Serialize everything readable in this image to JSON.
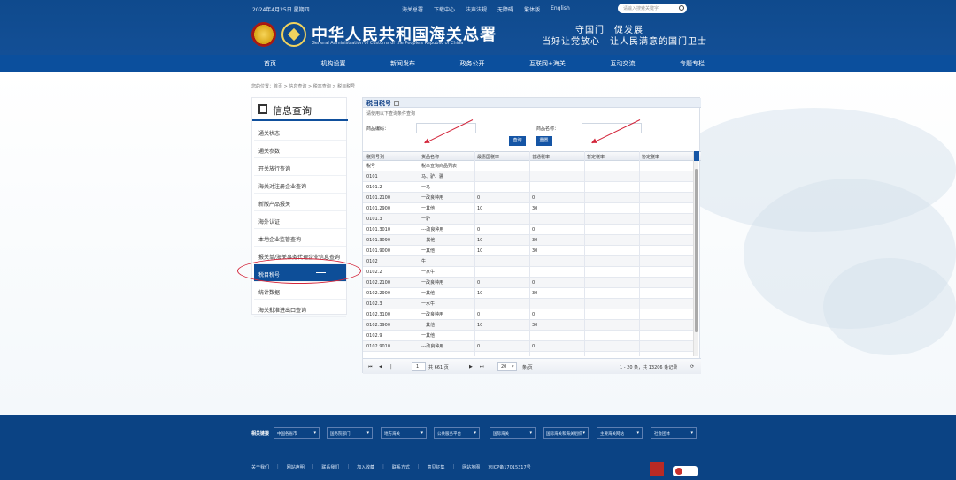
{
  "header": {
    "date": "2024年4月25日 星期四",
    "top_links": [
      "海关总署",
      "下载中心",
      "法声法规",
      "无障碍",
      "繁体版",
      "English"
    ],
    "search_placeholder": "请输入搜索关键字",
    "title_cn": "中华人民共和国海关总署",
    "title_en": "General Administration of Customs of the People's Republic of China",
    "slogan_line1": "守国门　促发展",
    "slogan_line2": "当好让党放心　让人民满意的国门卫士"
  },
  "nav": {
    "items": [
      "首页",
      "机构设置",
      "新闻发布",
      "政务公开",
      "互联网+海关",
      "互动交流",
      "专题专栏"
    ]
  },
  "breadcrumb": "您的位置：首页 > 信息查询 > 税率查询 > 税目税号",
  "sidebar": {
    "title": "信息查询",
    "items": [
      "通关状态",
      "通关参数",
      "开关放行查询",
      "海关对注册企业查询",
      "新版产品报关",
      "海外认证",
      "本地企业监管查询",
      "报关单/海关事务代理企业信息查询",
      "税目税号",
      "统计数据",
      "海关批准进出口查询"
    ],
    "active_index": 8
  },
  "panel": {
    "title": "税目税号",
    "hint": "请使用以下查询条件查询",
    "label_code": "商品编码：",
    "label_name": "商品名称：",
    "btn_query": "查询",
    "btn_reset": "重置",
    "columns": [
      "税则号列",
      "货品名称",
      "最惠国税率",
      "普通税率",
      "暂定税率",
      "协定税率"
    ],
    "rows": [
      [
        "税号",
        "税率查询商品列表",
        "",
        "",
        "",
        ""
      ],
      [
        "0101",
        "马、驴、骡",
        "",
        "",
        "",
        ""
      ],
      [
        "0101.2",
        "一马",
        "",
        "",
        "",
        ""
      ],
      [
        "0101.2100",
        "一改良种用",
        "0",
        "0",
        "",
        ""
      ],
      [
        "0101.2900",
        "一其他",
        "10",
        "30",
        "",
        ""
      ],
      [
        "0101.3",
        "一驴",
        "",
        "",
        "",
        ""
      ],
      [
        "0101.3010",
        "---改良种用",
        "0",
        "0",
        "",
        ""
      ],
      [
        "0101.3090",
        "---其他",
        "10",
        "30",
        "",
        ""
      ],
      [
        "0101.9000",
        "一其他",
        "10",
        "30",
        "",
        ""
      ],
      [
        "0102",
        "牛",
        "",
        "",
        "",
        ""
      ],
      [
        "0102.2",
        "一家牛",
        "",
        "",
        "",
        ""
      ],
      [
        "0102.2100",
        "一改良种用",
        "0",
        "0",
        "",
        ""
      ],
      [
        "0102.2900",
        "一其他",
        "10",
        "30",
        "",
        ""
      ],
      [
        "0102.3",
        "一水牛",
        "",
        "",
        "",
        ""
      ],
      [
        "0102.3100",
        "一改良种用",
        "0",
        "0",
        "",
        ""
      ],
      [
        "0102.3900",
        "一其他",
        "10",
        "30",
        "",
        ""
      ],
      [
        "0102.9",
        "一其他",
        "",
        "",
        "",
        ""
      ],
      [
        "0102.9010",
        "---改良种用",
        "0",
        "0",
        "",
        ""
      ]
    ],
    "pager": {
      "page_value": "1",
      "page_total": "共 661 页",
      "page_size": "20",
      "page_size_suffix": "条/页",
      "summary": "1 - 20 条，共 13206 条记录"
    }
  },
  "footer": {
    "label": "相关链接",
    "selects": [
      "中国各省市",
      "国务院部门",
      "地方海关",
      "公共服务平台",
      "国际海关",
      "国际海关和海关组织",
      "主要海关网站",
      "社会团体"
    ],
    "links": [
      "关于我们",
      "网站声明",
      "联系我们",
      "加入收藏",
      "联系方式",
      "意见征集",
      "网站地图",
      "京ICP备17015317号"
    ]
  }
}
